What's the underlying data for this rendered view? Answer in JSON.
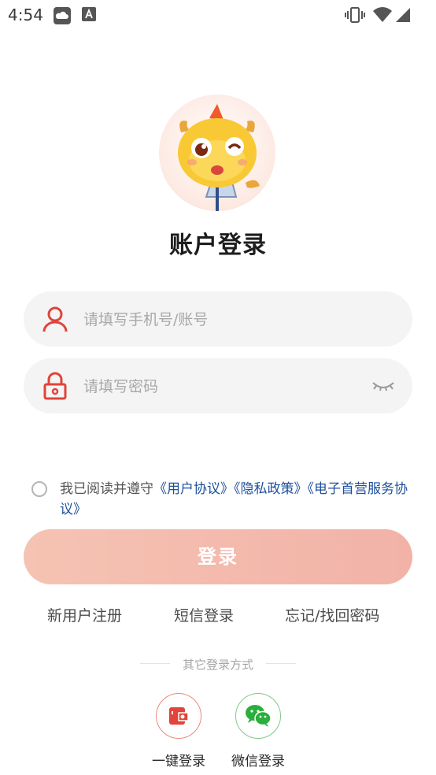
{
  "status_bar": {
    "time": "4:54"
  },
  "login": {
    "title": "账户登录",
    "phone_placeholder": "请填写手机号/账号",
    "password_placeholder": "请填写密码",
    "agreement_prefix": "我已阅读并遵守",
    "agreement_links": [
      "《用户协议》",
      "《隐私政策》",
      "《电子首营服务协议》"
    ],
    "login_button": "登录",
    "register_link": "新用户注册",
    "sms_login_link": "短信登录",
    "forgot_link": "忘记/找回密码",
    "other_methods_label": "其它登录方式",
    "one_click_label": "一键登录",
    "wechat_label": "微信登录"
  },
  "colors": {
    "accent_red": "#e0443a",
    "button_gradient_start": "#f5c3b3",
    "button_gradient_end": "#f2b2a7",
    "link_blue": "#1d4f9c",
    "wechat_green": "#2aae3c"
  },
  "icons": [
    "cloud-icon",
    "font-download-icon",
    "vibrate-icon",
    "wifi-icon",
    "signal-icon",
    "user-icon",
    "lock-icon",
    "eye-closed-icon",
    "one-click-login-icon",
    "wechat-icon"
  ]
}
